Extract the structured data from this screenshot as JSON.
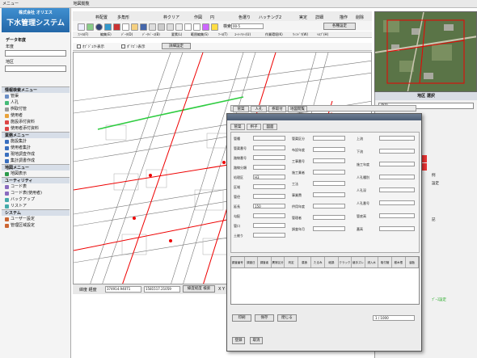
{
  "menubar": {
    "items": [
      "メニュー",
      "地図閲覧"
    ]
  },
  "logo": {
    "company": "株式会社 オリエス",
    "system": "下水管理システム"
  },
  "sidebar": {
    "data_year_label": "データ年度",
    "year_label": "年度",
    "district_label": "地区",
    "sections": [
      {
        "header": "情報検索メニュー",
        "items": [
          "管渠",
          "人孔",
          "桝取付管",
          "使用者",
          "施設添付資料",
          "使用者添付資料"
        ]
      },
      {
        "header": "業務メニュー",
        "items": [
          "施設集計",
          "使用者集計",
          "現地調査作成",
          "集計調書作成"
        ]
      },
      {
        "header": "地図メニュー",
        "items": [
          "地図表示"
        ]
      },
      {
        "header": "ユーティリティ",
        "items": [
          "コード表",
          "コード表(使用者)",
          "バックアップ",
          "リストア"
        ]
      },
      {
        "header": "システム",
        "items": [
          "ユーザー設定",
          "管理区域設定"
        ]
      }
    ]
  },
  "toolbar": {
    "items": [
      "枠配置",
      "多角形",
      "枠クリア",
      "作図",
      "円",
      "色選り",
      "ハッチング2",
      "実定",
      "詳細",
      "描作",
      "削除"
    ],
    "search_label": "検索",
    "search_value": "00-5",
    "settings_button": "各種設定",
    "menu_row": [
      "ﾌｧｲﾙ(F)",
      "編集(E)",
      "ﾃﾞｰﾀ(D)",
      "ﾃﾞｰﾀﾍﾞｰｽ(B)",
      "要素(L)",
      "範囲編集(S)",
      "ﾂｰﾙ(T)",
      "ﾕｰﾃｨﾘﾃｨ(U)",
      "作業環境(K)",
      "ｳｨﾝﾄﾞｳ(W)",
      "ﾍﾙﾌﾟ(H)"
    ],
    "check1": "ｵﾌﾞｼﾞｪｸﾄ表示",
    "check2": "ﾎﾟﾘｺﾞﾝ表示",
    "detail_button": "詳細設定"
  },
  "status": {
    "label": "緯度 経度",
    "lat": "374914.94071",
    "lon": "1581517.21059",
    "search_btn": "緯度経度 検索",
    "coord": "X Y Co"
  },
  "right_panel": {
    "title": "地区 選択",
    "select_value": "施設",
    "button_red": "表示",
    "button_red2": "表示クリア",
    "list_items": [
      "例",
      "設定",
      "記",
      "ﾌﾟｰｽ設定"
    ]
  },
  "dialog": {
    "tabs": [
      "管渠",
      "人孔",
      "桝取付",
      "地図閲覧"
    ],
    "subtabs": [
      "管渠",
      "桝子",
      "図面"
    ],
    "fields_left": [
      "管種",
      "管渠番号",
      "路線番号",
      "路線分類",
      "処理区",
      "区域",
      "管径",
      "延長",
      "勾配",
      "管口",
      "土被り"
    ],
    "fields_mid": [
      "管渠区分",
      "布設年度",
      "工事番号",
      "施工業者",
      "工法",
      "事業費",
      "供用年度",
      "管理者",
      "調査年月"
    ],
    "values": [
      "",
      "",
      "",
      "",
      "H3",
      "",
      "",
      "150",
      "",
      ""
    ],
    "right_labels": [
      "上流",
      "下流",
      "施工年度",
      "人孔種別",
      "人孔深",
      "人孔番号",
      "管底高",
      "蓋高"
    ],
    "table_headers": [
      "調査番号",
      "調査日",
      "調査者",
      "異常区分",
      "判定",
      "腐食",
      "たるみ",
      "破損",
      "クラック",
      "継手ズレ",
      "浸入水",
      "取付管",
      "樹木根",
      "油脂"
    ],
    "footer_buttons": [
      "印刷",
      "保存",
      "閉じる"
    ],
    "page": "1 / 1000",
    "bottom_buttons": [
      "登録",
      "取消"
    ]
  }
}
